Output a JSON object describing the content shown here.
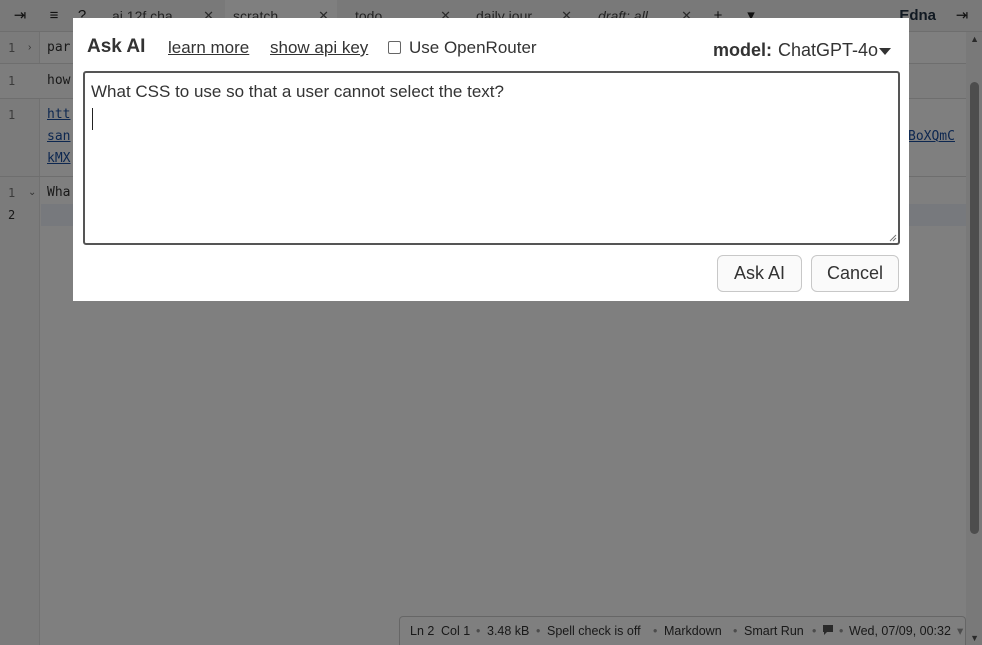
{
  "tabs": [
    {
      "label": "ai 12f cha",
      "close": "✕"
    },
    {
      "label": "scratch",
      "close": "✕"
    },
    {
      "label": "todo",
      "close": "✕"
    },
    {
      "label": "daily jour",
      "close": "✕"
    },
    {
      "label": "draft: all",
      "close": "✕"
    }
  ],
  "tabbar": {
    "add_tab": "+",
    "menu": "≡",
    "help": "?",
    "app_title": "Edna",
    "sidebar_toggle_left": "⇥",
    "sidebar_toggle_right": "⇥",
    "tab_overflow": "▾"
  },
  "editor": {
    "notes": [
      {
        "line_number": "1",
        "fold": "›",
        "text": "par"
      },
      {
        "line_number": "1",
        "text": "how"
      },
      {
        "line_number": "1",
        "lines": [
          "htt",
          "san",
          "kMX"
        ],
        "right_fragment": "BoXQmC"
      },
      {
        "line_number": "1",
        "fold": "⌄",
        "text": "Wha",
        "line2_number": "2"
      }
    ]
  },
  "status": {
    "ln": "Ln 2",
    "col": "Col 1",
    "size": "3.48 kB",
    "spell": "Spell check is off",
    "language": "Markdown",
    "run": "Smart Run",
    "datetime": "Wed, 07/09, 00:32",
    "sep": "•",
    "more": "▾"
  },
  "dialog": {
    "title": "Ask AI",
    "learn_more": "learn more",
    "show_api_key": "show api key",
    "openrouter_label": "Use OpenRouter",
    "openrouter_checked": false,
    "model_label": "model:",
    "model_value": "ChatGPT-4o",
    "prompt_text": "What CSS to use so that a user cannot select the text?",
    "ask_button": "Ask AI",
    "cancel_button": "Cancel"
  }
}
